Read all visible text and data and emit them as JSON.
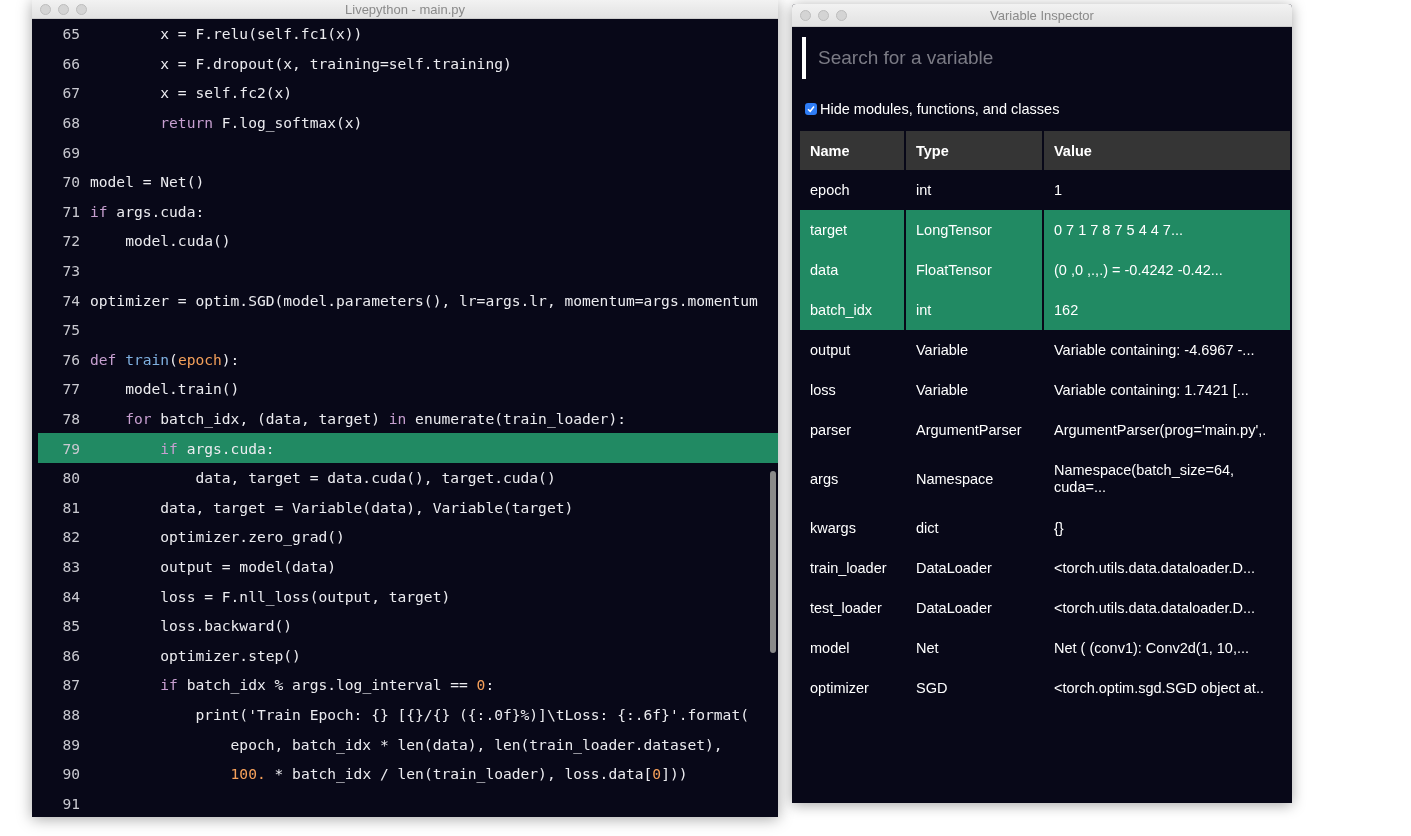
{
  "editor": {
    "title": "Livepython - main.py",
    "lines": [
      {
        "number": "65",
        "highlighted": false,
        "tokens": [
          {
            "kind": "plain",
            "text": "        x = F.relu(self.fc1(x))"
          }
        ]
      },
      {
        "number": "66",
        "highlighted": false,
        "tokens": [
          {
            "kind": "plain",
            "text": "        x = F.dropout(x, training=self.training)"
          }
        ]
      },
      {
        "number": "67",
        "highlighted": false,
        "tokens": [
          {
            "kind": "plain",
            "text": "        x = self.fc2(x)"
          }
        ]
      },
      {
        "number": "68",
        "highlighted": false,
        "tokens": [
          {
            "kind": "keyword",
            "text": "        return"
          },
          {
            "kind": "plain",
            "text": " F.log_softmax(x)"
          }
        ]
      },
      {
        "number": "69",
        "highlighted": false
      },
      {
        "number": "70",
        "highlighted": false,
        "tokens": [
          {
            "kind": "plain",
            "text": "model = Net()"
          }
        ]
      },
      {
        "number": "71",
        "highlighted": false,
        "tokens": [
          {
            "kind": "keyword",
            "text": "if"
          },
          {
            "kind": "plain",
            "text": " args.cuda:"
          }
        ]
      },
      {
        "number": "72",
        "highlighted": false,
        "tokens": [
          {
            "kind": "plain",
            "text": "    model.cuda()"
          }
        ]
      },
      {
        "number": "73",
        "highlighted": false
      },
      {
        "number": "74",
        "highlighted": false,
        "tokens": [
          {
            "kind": "plain",
            "text": "optimizer = optim.SGD(model.parameters(), lr=args.lr, momentum=args.momentum"
          }
        ]
      },
      {
        "number": "75",
        "highlighted": false
      },
      {
        "number": "76",
        "highlighted": false,
        "tokens": [
          {
            "kind": "keyword",
            "text": "def"
          },
          {
            "kind": "function",
            "text": " train"
          },
          {
            "kind": "plain",
            "text": "("
          },
          {
            "kind": "param",
            "text": "epoch"
          },
          {
            "kind": "plain",
            "text": "):"
          }
        ]
      },
      {
        "number": "77",
        "highlighted": false,
        "tokens": [
          {
            "kind": "plain",
            "text": "    model.train()"
          }
        ]
      },
      {
        "number": "78",
        "highlighted": false,
        "tokens": [
          {
            "kind": "keyword",
            "text": "    for"
          },
          {
            "kind": "plain",
            "text": " batch_idx, (data, target) "
          },
          {
            "kind": "keyword",
            "text": "in"
          },
          {
            "kind": "plain",
            "text": " enumerate(train_loader):"
          }
        ]
      },
      {
        "number": "79",
        "highlighted": true,
        "tokens": [
          {
            "kind": "keyword",
            "text": "        if"
          },
          {
            "kind": "plain",
            "text": " args.cuda:"
          }
        ]
      },
      {
        "number": "80",
        "highlighted": false,
        "tokens": [
          {
            "kind": "plain",
            "text": "            data, target = data.cuda(), target.cuda()"
          }
        ]
      },
      {
        "number": "81",
        "highlighted": false,
        "tokens": [
          {
            "kind": "plain",
            "text": "        data, target = Variable(data), Variable(target)"
          }
        ]
      },
      {
        "number": "82",
        "highlighted": false,
        "tokens": [
          {
            "kind": "plain",
            "text": "        optimizer.zero_grad()"
          }
        ]
      },
      {
        "number": "83",
        "highlighted": false,
        "tokens": [
          {
            "kind": "plain",
            "text": "        output = model(data)"
          }
        ]
      },
      {
        "number": "84",
        "highlighted": false,
        "tokens": [
          {
            "kind": "plain",
            "text": "        loss = F.nll_loss(output, target)"
          }
        ]
      },
      {
        "number": "85",
        "highlighted": false,
        "tokens": [
          {
            "kind": "plain",
            "text": "        loss.backward()"
          }
        ]
      },
      {
        "number": "86",
        "highlighted": false,
        "tokens": [
          {
            "kind": "plain",
            "text": "        optimizer.step()"
          }
        ]
      },
      {
        "number": "87",
        "highlighted": false,
        "tokens": [
          {
            "kind": "keyword",
            "text": "        if"
          },
          {
            "kind": "plain",
            "text": " batch_idx % args.log_interval == "
          },
          {
            "kind": "number",
            "text": "0"
          },
          {
            "kind": "plain",
            "text": ":"
          }
        ]
      },
      {
        "number": "88",
        "highlighted": false,
        "tokens": [
          {
            "kind": "plain",
            "text": "            print('Train Epoch: {} [{}/{} ({:.0f}%)]\\tLoss: {:.6f}'.format("
          }
        ]
      },
      {
        "number": "89",
        "highlighted": false,
        "tokens": [
          {
            "kind": "plain",
            "text": "                epoch, batch_idx * len(data), len(train_loader.dataset),"
          }
        ]
      },
      {
        "number": "90",
        "highlighted": false,
        "tokens": [
          {
            "kind": "number",
            "text": "                100."
          },
          {
            "kind": "plain",
            "text": " * batch_idx / len(train_loader), loss.data["
          },
          {
            "kind": "number",
            "text": "0"
          },
          {
            "kind": "plain",
            "text": "]))"
          }
        ]
      },
      {
        "number": "91",
        "highlighted": false
      }
    ]
  },
  "inspector": {
    "title": "Variable Inspector",
    "search": {
      "placeholder": "Search for a variable"
    },
    "filter": {
      "label": "Hide modules, functions, and classes",
      "checked": true
    },
    "table": {
      "columns": [
        "Name",
        "Type",
        "Value"
      ],
      "rows": [
        {
          "name": "epoch",
          "type": "int",
          "value": "1",
          "highlighted": false
        },
        {
          "name": "target",
          "type": "LongTensor",
          "value": "0 7 1 7 8 7 5 4 4 7...",
          "highlighted": true
        },
        {
          "name": "data",
          "type": "FloatTensor",
          "value": "(0 ,0 ,.,.) = -0.4242 -0.42...",
          "highlighted": true
        },
        {
          "name": "batch_idx",
          "type": "int",
          "value": "162",
          "highlighted": true
        },
        {
          "name": "output",
          "type": "Variable",
          "value": "Variable containing: -4.6967 -...",
          "highlighted": false
        },
        {
          "name": "loss",
          "type": "Variable",
          "value": "Variable containing: 1.7421 [...",
          "highlighted": false
        },
        {
          "name": "parser",
          "type": "ArgumentParser",
          "value": "ArgumentParser(prog='main.py',.",
          "highlighted": false
        },
        {
          "name": "args",
          "type": "Namespace",
          "value": "Namespace(batch_size=64, cuda=...",
          "highlighted": false
        },
        {
          "name": "kwargs",
          "type": "dict",
          "value": "{}",
          "highlighted": false
        },
        {
          "name": "train_loader",
          "type": "DataLoader",
          "value": "<torch.utils.data.dataloader.D...",
          "highlighted": false
        },
        {
          "name": "test_loader",
          "type": "DataLoader",
          "value": "<torch.utils.data.dataloader.D...",
          "highlighted": false
        },
        {
          "name": "model",
          "type": "Net",
          "value": "Net ( (conv1): Conv2d(1, 10,...",
          "highlighted": false
        },
        {
          "name": "optimizer",
          "type": "SGD",
          "value": "<torch.optim.sgd.SGD object at..",
          "highlighted": false
        }
      ]
    }
  }
}
